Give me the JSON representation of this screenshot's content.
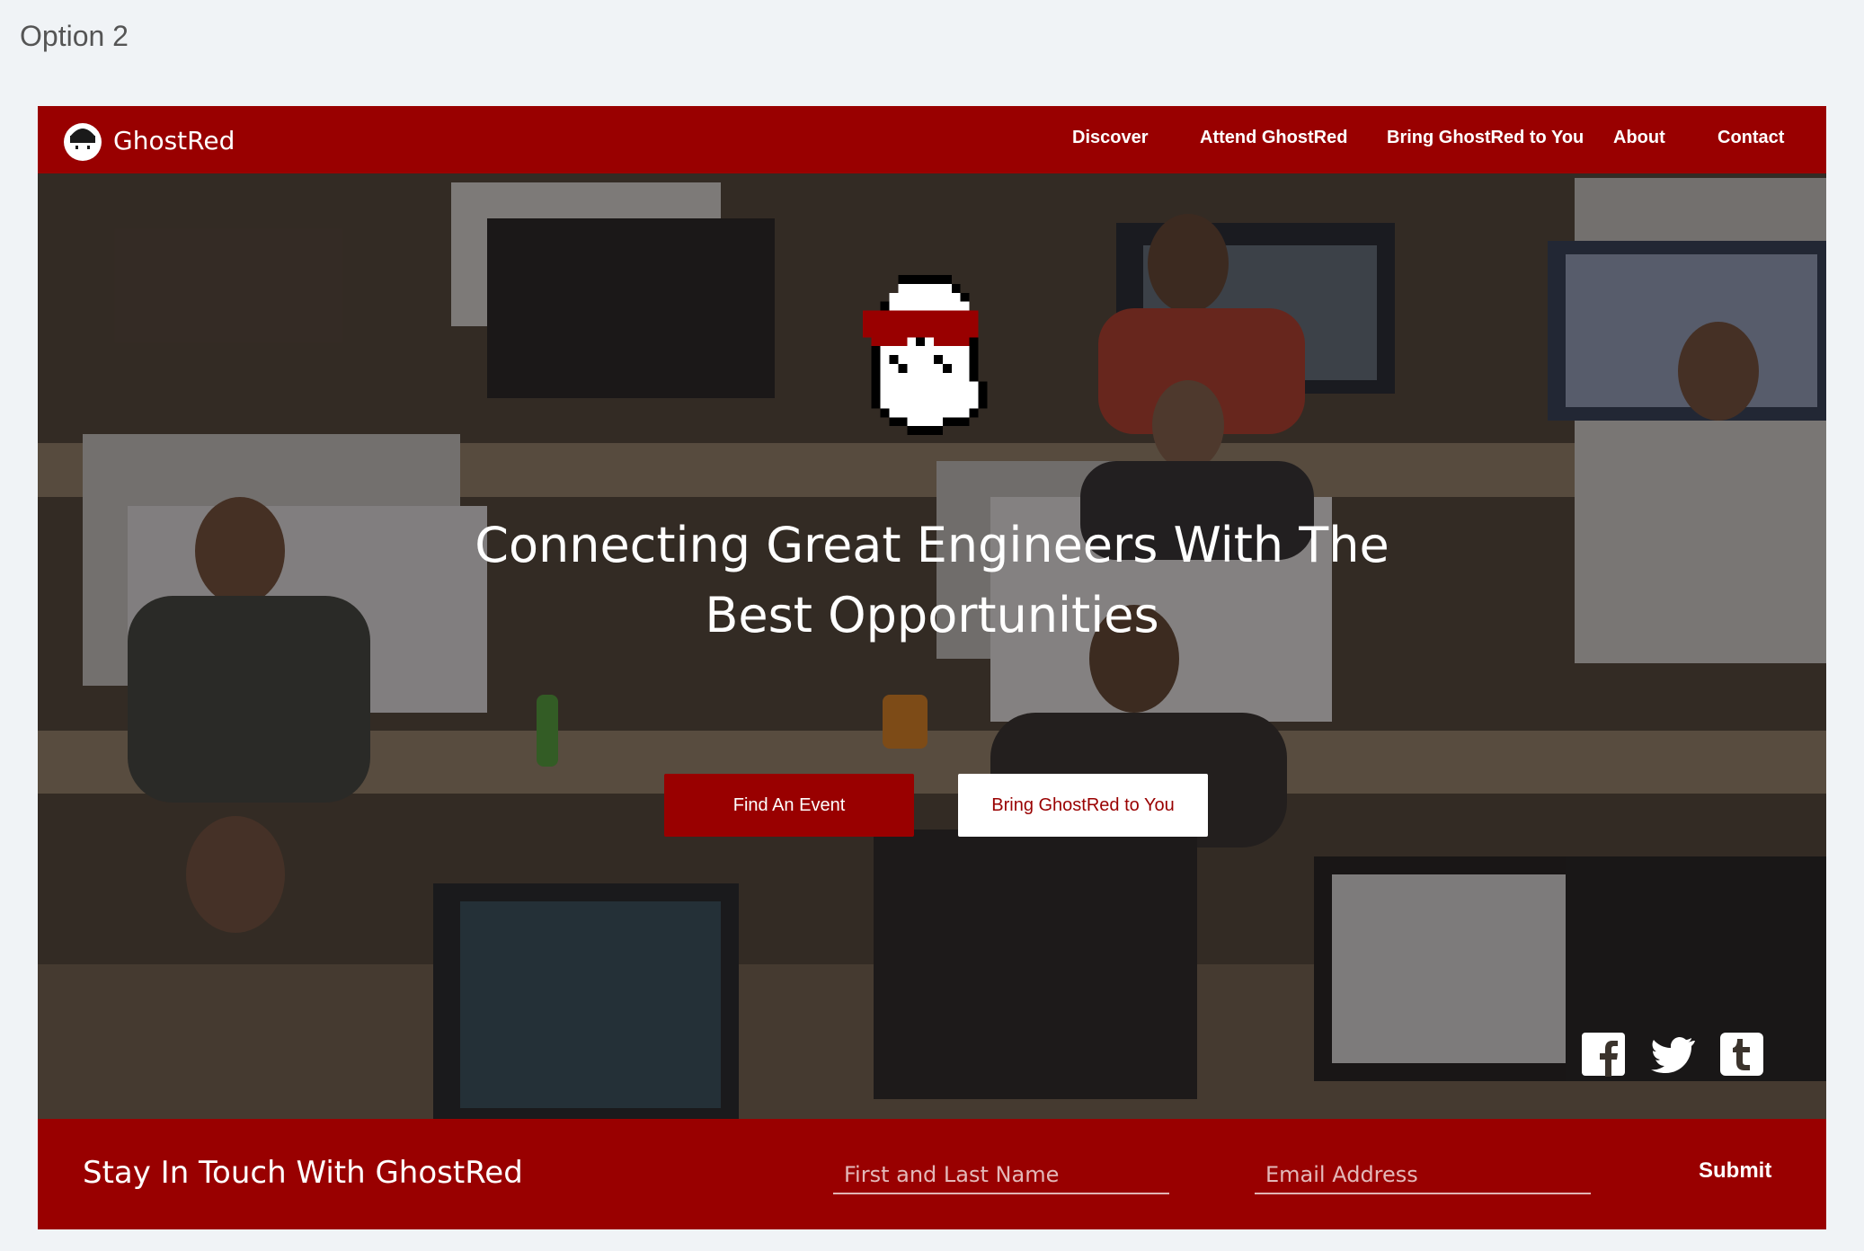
{
  "page": {
    "label": "Option 2"
  },
  "header": {
    "brand": "GhostRed",
    "nav": [
      "Discover",
      "Attend GhostRed",
      "Bring GhostRed to You",
      "About",
      "Contact"
    ]
  },
  "hero": {
    "headline_line1": "Connecting Great Engineers With The",
    "headline_line2": "Best Opportunities",
    "primary_button": "Find An Event",
    "secondary_button": "Bring GhostRed to You",
    "social_icons": [
      "facebook-icon",
      "twitter-icon",
      "tumblr-icon"
    ]
  },
  "footer": {
    "title": "Stay In Touch With GhostRed",
    "name_placeholder": "First and Last Name",
    "email_placeholder": "Email Address",
    "submit": "Submit"
  },
  "colors": {
    "brand_red": "#990000",
    "page_bg": "#f0f3f6",
    "text_white": "#ffffff"
  }
}
